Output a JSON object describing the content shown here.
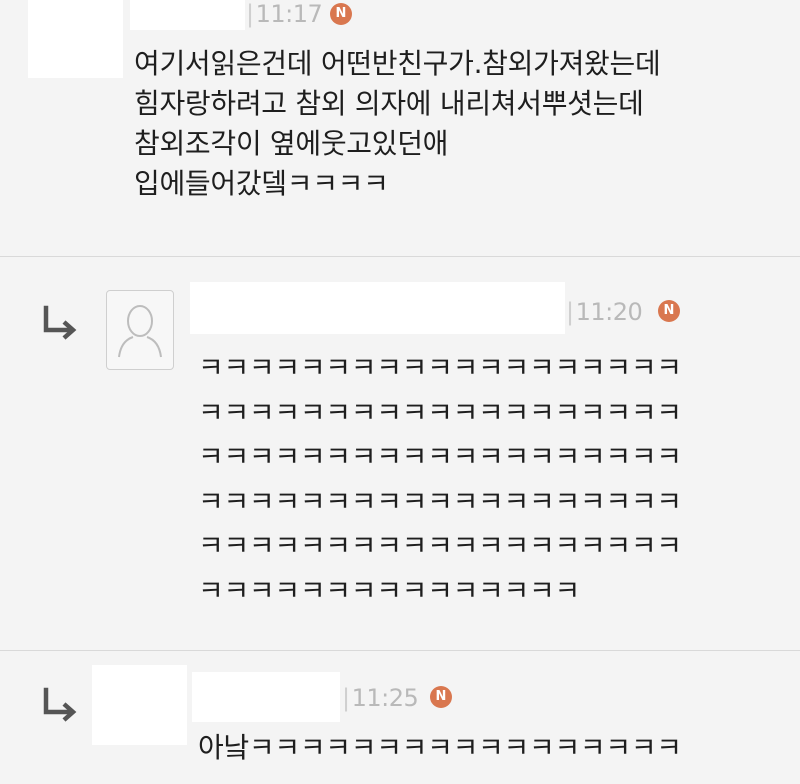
{
  "comments": [
    {
      "time": "11:17",
      "badge": "N",
      "text": "여기서읽은건데 어떤반친구가.참외가져왔는데\n힘자랑하려고 참외 의자에 내리쳐서뿌셧는데\n참외조각이 옆에웃고있던애\n입에들어갔뎈ㅋㅋㅋㅋ"
    },
    {
      "time": "11:20",
      "badge": "N",
      "text": "ㅋㅋㅋㅋㅋㅋㅋㅋㅋㅋㅋㅋㅋㅋㅋㅋㅋㅋㅋ\nㅋㅋㅋㅋㅋㅋㅋㅋㅋㅋㅋㅋㅋㅋㅋㅋㅋㅋㅋ\nㅋㅋㅋㅋㅋㅋㅋㅋㅋㅋㅋㅋㅋㅋㅋㅋㅋㅋㅋ\nㅋㅋㅋㅋㅋㅋㅋㅋㅋㅋㅋㅋㅋㅋㅋㅋㅋㅋㅋ\nㅋㅋㅋㅋㅋㅋㅋㅋㅋㅋㅋㅋㅋㅋㅋㅋㅋㅋㅋ\nㅋㅋㅋㅋㅋㅋㅋㅋㅋㅋㅋㅋㅋㅋㅋ"
    },
    {
      "time": "11:25",
      "badge": "N",
      "text": "아낰ㅋㅋㅋㅋㅋㅋㅋㅋㅋㅋㅋㅋㅋㅋㅋㅋㅋ"
    }
  ],
  "icons": {
    "reply": "reply-arrow-icon",
    "avatar": "default-avatar-icon"
  },
  "colors": {
    "badge": "#d9774f",
    "background": "#f4f4f4",
    "divider": "#d9d9d9",
    "timestamp": "#b9b9b9"
  }
}
